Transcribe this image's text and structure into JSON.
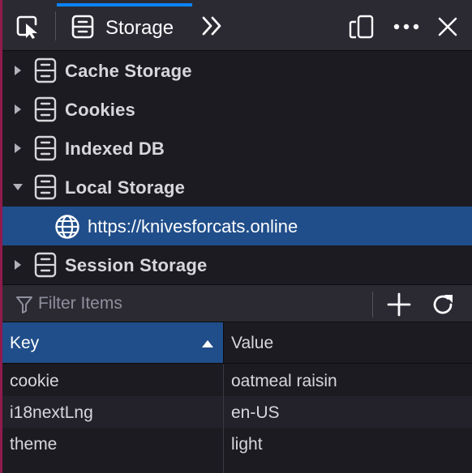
{
  "toolbar": {
    "active_tab_label": "Storage",
    "icons": {
      "pick": "pick-element-icon",
      "tab": "storage-icon",
      "overflow": "chevron-double-right-icon",
      "responsive": "responsive-design-icon",
      "more": "ellipsis-icon",
      "close": "close-icon"
    }
  },
  "tree": {
    "items": [
      {
        "label": "Cache Storage",
        "expanded": false
      },
      {
        "label": "Cookies",
        "expanded": false
      },
      {
        "label": "Indexed DB",
        "expanded": false
      },
      {
        "label": "Local Storage",
        "expanded": true
      },
      {
        "label": "Session Storage",
        "expanded": false
      }
    ],
    "selected_origin": "https://knivesforcats.online"
  },
  "filter": {
    "placeholder": "Filter Items",
    "value": ""
  },
  "table": {
    "columns": [
      "Key",
      "Value"
    ],
    "sorted_column": "Key",
    "sort_direction": "ascending",
    "rows": [
      {
        "key": "cookie",
        "value": "oatmeal raisin"
      },
      {
        "key": "i18nextLng",
        "value": "en-US"
      },
      {
        "key": "theme",
        "value": "light"
      }
    ]
  },
  "colors": {
    "accent": "#0a84ff",
    "selection": "#204e8a",
    "background": "#1c1b22",
    "toolbar": "#2b2a33"
  }
}
